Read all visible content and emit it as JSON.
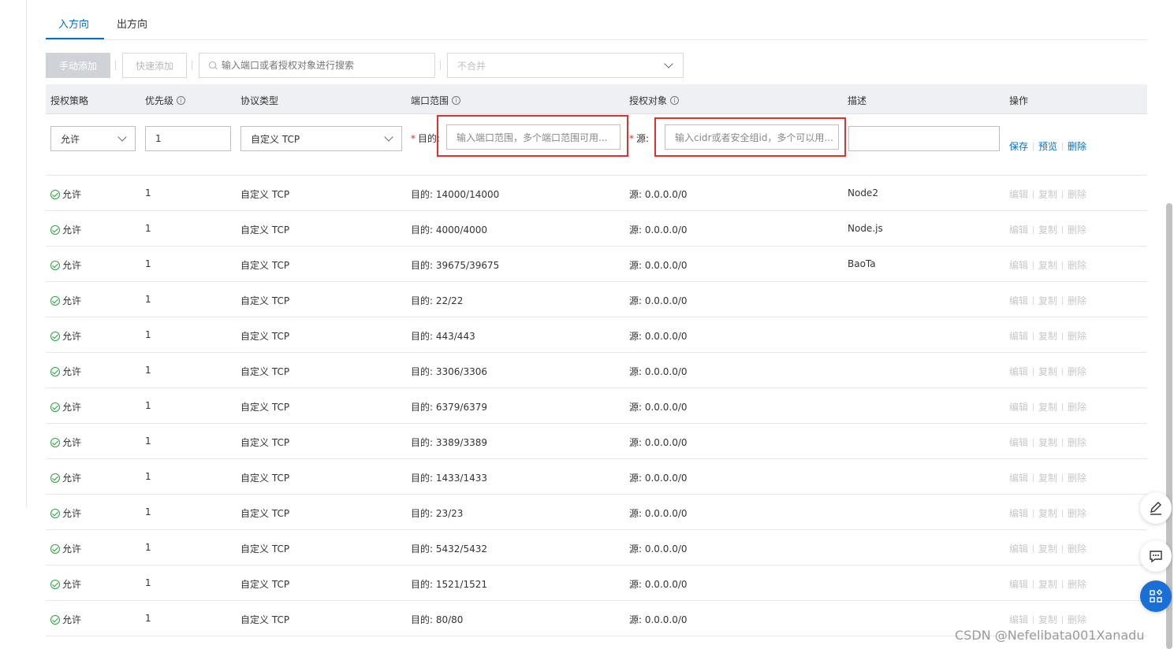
{
  "tabs": [
    {
      "label": "入方向",
      "active": true
    },
    {
      "label": "出方向",
      "active": false
    }
  ],
  "toolbar": {
    "manual_add": "手动添加",
    "quick_add": "快速添加",
    "search_placeholder": "输入端口或者授权对象进行搜索",
    "merge_select": "不合并"
  },
  "table": {
    "headers": [
      "授权策略",
      "优先级",
      "协议类型",
      "端口范围",
      "授权对象",
      "描述",
      "操作"
    ],
    "edit_row": {
      "policy": "允许",
      "priority": "1",
      "protocol": "自定义 TCP",
      "dest_label": "目的",
      "dest_placeholder": "输入端口范围，多个端口范围可用...",
      "source_label": "源",
      "source_placeholder": "输入cidr或者安全组id，多个可以用...",
      "description": "",
      "actions": [
        "保存",
        "预览",
        "删除"
      ]
    },
    "rows": [
      {
        "policy": "允许",
        "priority": "1",
        "protocol": "自定义 TCP",
        "port": "目的: 14000/14000",
        "source": "源: 0.0.0.0/0",
        "desc": "Node2"
      },
      {
        "policy": "允许",
        "priority": "1",
        "protocol": "自定义 TCP",
        "port": "目的: 4000/4000",
        "source": "源: 0.0.0.0/0",
        "desc": "Node.js"
      },
      {
        "policy": "允许",
        "priority": "1",
        "protocol": "自定义 TCP",
        "port": "目的: 39675/39675",
        "source": "源: 0.0.0.0/0",
        "desc": "BaoTa"
      },
      {
        "policy": "允许",
        "priority": "1",
        "protocol": "自定义 TCP",
        "port": "目的: 22/22",
        "source": "源: 0.0.0.0/0",
        "desc": ""
      },
      {
        "policy": "允许",
        "priority": "1",
        "protocol": "自定义 TCP",
        "port": "目的: 443/443",
        "source": "源: 0.0.0.0/0",
        "desc": ""
      },
      {
        "policy": "允许",
        "priority": "1",
        "protocol": "自定义 TCP",
        "port": "目的: 3306/3306",
        "source": "源: 0.0.0.0/0",
        "desc": ""
      },
      {
        "policy": "允许",
        "priority": "1",
        "protocol": "自定义 TCP",
        "port": "目的: 6379/6379",
        "source": "源: 0.0.0.0/0",
        "desc": ""
      },
      {
        "policy": "允许",
        "priority": "1",
        "protocol": "自定义 TCP",
        "port": "目的: 3389/3389",
        "source": "源: 0.0.0.0/0",
        "desc": ""
      },
      {
        "policy": "允许",
        "priority": "1",
        "protocol": "自定义 TCP",
        "port": "目的: 1433/1433",
        "source": "源: 0.0.0.0/0",
        "desc": ""
      },
      {
        "policy": "允许",
        "priority": "1",
        "protocol": "自定义 TCP",
        "port": "目的: 23/23",
        "source": "源: 0.0.0.0/0",
        "desc": ""
      },
      {
        "policy": "允许",
        "priority": "1",
        "protocol": "自定义 TCP",
        "port": "目的: 5432/5432",
        "source": "源: 0.0.0.0/0",
        "desc": ""
      },
      {
        "policy": "允许",
        "priority": "1",
        "protocol": "自定义 TCP",
        "port": "目的: 1521/1521",
        "source": "源: 0.0.0.0/0",
        "desc": ""
      },
      {
        "policy": "允许",
        "priority": "1",
        "protocol": "自定义 TCP",
        "port": "目的: 80/80",
        "source": "源: 0.0.0.0/0",
        "desc": ""
      }
    ],
    "row_actions": [
      "编辑",
      "复制",
      "删除"
    ]
  },
  "watermark": "CSDN @Nefelibata001Xanadu",
  "colors": {
    "accent": "#0070cc",
    "highlight": "#e03131",
    "success": "#2aa33a",
    "fab_blue": "#1a6fd6"
  }
}
